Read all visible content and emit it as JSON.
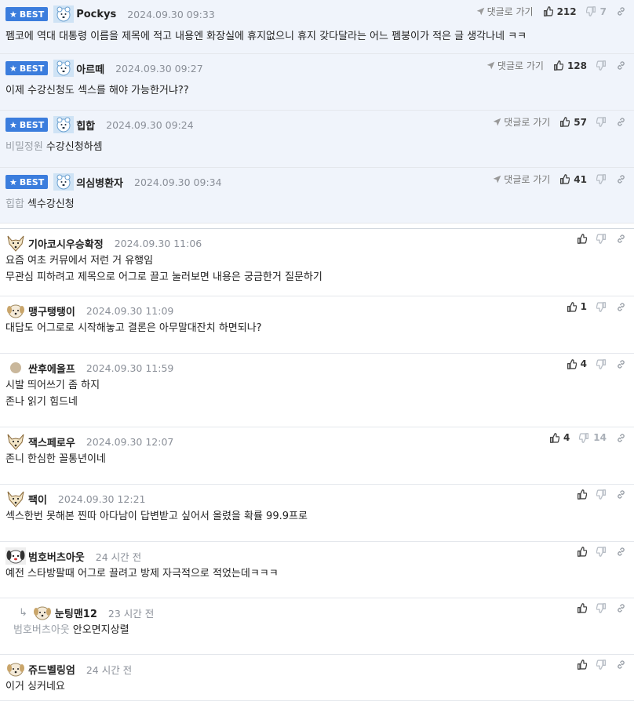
{
  "badge_label": "BEST",
  "reply_link_label": "댓글로 가기",
  "best": [
    {
      "nick": "Pockys",
      "date": "2024.09.30 09:33",
      "quote": "",
      "lines": [
        "펨코에 역대 대통령 이름을 제목에 적고 내용엔 화장실에 휴지없으니 휴지 갖다달라는 어느 펨붕이가 적은 글 생각나네 ㅋㅋ"
      ],
      "likes": "212",
      "dislikes": "7",
      "avatar": "polar-bear-avatar"
    },
    {
      "nick": "아르떼",
      "date": "2024.09.30 09:27",
      "quote": "",
      "lines": [
        "이제 수강신청도 섹스를 해야 가능한거냐??"
      ],
      "likes": "128",
      "dislikes": "",
      "avatar": "polar-bear-avatar"
    },
    {
      "nick": "힙합",
      "date": "2024.09.30 09:24",
      "quote": "비밀정원",
      "lines": [
        "수강신청하셈"
      ],
      "likes": "57",
      "dislikes": "",
      "avatar": "polar-bear-avatar"
    },
    {
      "nick": "의심병환자",
      "date": "2024.09.30 09:34",
      "quote": "힙합",
      "lines": [
        "섹수강신청"
      ],
      "likes": "41",
      "dislikes": "",
      "avatar": "polar-bear-avatar"
    }
  ],
  "comments": [
    {
      "nick": "기아코시우승확정",
      "date": "2024.09.30 11:06",
      "quote": "",
      "lines": [
        "요즘 여초 커뮤에서 저런 거 유행임",
        "무관심 피하려고 제목으로 어그로 끌고 눌러보면 내용은 궁금한거 질문하기"
      ],
      "likes": "",
      "dislikes": "",
      "avatar": "fox-avatar",
      "reply": false
    },
    {
      "nick": "맹구탱탱이",
      "date": "2024.09.30 11:09",
      "quote": "",
      "lines": [
        "대답도 어그로로 시작해놓고 결론은 아무말대잔치 하면되나?"
      ],
      "likes": "1",
      "dislikes": "",
      "avatar": "puppy-avatar",
      "reply": false
    },
    {
      "nick": "싼후에올프",
      "date": "2024.09.30 11:59",
      "quote": "",
      "lines": [
        "시발 띄어쓰기 좀 하지",
        "존나 읽기 힘드네"
      ],
      "likes": "4",
      "dislikes": "",
      "avatar": "dot-avatar",
      "reply": false
    },
    {
      "nick": "잭스페로우",
      "date": "2024.09.30 12:07",
      "quote": "",
      "lines": [
        "존니 한심한 꼴통년이네"
      ],
      "likes": "4",
      "dislikes": "14",
      "avatar": "fox-avatar",
      "reply": false
    },
    {
      "nick": "팩이",
      "date": "2024.09.30 12:21",
      "quote": "",
      "lines": [
        "섹스한번 못해본 찐따 아다남이 답변받고 싶어서 올렸을 확률 99.9프로"
      ],
      "likes": "",
      "dislikes": "",
      "avatar": "fox-avatar",
      "reply": false
    },
    {
      "nick": "범호버츠아웃",
      "date": "24 시간 전",
      "quote": "",
      "lines": [
        "예전 스타방팔때 어그로 끌려고 방제 자극적으로 적었는데ㅋㅋㅋ"
      ],
      "likes": "",
      "dislikes": "",
      "avatar": "dog-avatar",
      "reply": false
    },
    {
      "nick": "눈팅맨12",
      "date": "23 시간 전",
      "quote": "범호버츠아웃",
      "lines": [
        "안오면지상렬"
      ],
      "likes": "",
      "dislikes": "",
      "avatar": "puppy-avatar",
      "reply": true
    },
    {
      "nick": "쥬드벨링엄",
      "date": "24 시간 전",
      "quote": "",
      "lines": [
        "이거 싱커네요"
      ],
      "likes": "",
      "dislikes": "",
      "avatar": "puppy-avatar",
      "reply": false
    }
  ]
}
